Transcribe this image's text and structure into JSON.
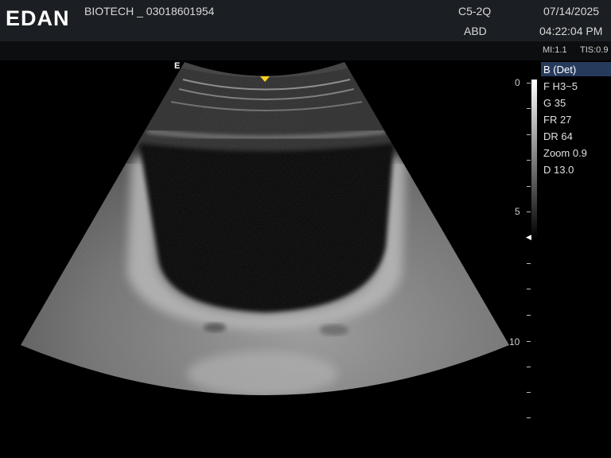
{
  "header": {
    "logo": "EDAN",
    "patient_id": "BIOTECH _ 03018601954",
    "probe": "C5-2Q",
    "preset": "ABD",
    "date": "07/14/2025",
    "time": "04:22:04 PM"
  },
  "indices": {
    "mi": "MI:1.1",
    "tis": "TIS:0.9"
  },
  "mode": {
    "label": "B (Det)",
    "params": [
      "F H3~5",
      "G 35",
      "FR 27",
      "DR 64",
      "Zoom 0.9",
      "D 13.0"
    ]
  },
  "depth_scale": {
    "labels": [
      "0",
      "5",
      "10"
    ]
  },
  "image": {
    "orientation_mark": "E",
    "focus_marker": "◀",
    "marker_color": "#ffd21a",
    "mode_highlight_color": "#263a5c"
  }
}
